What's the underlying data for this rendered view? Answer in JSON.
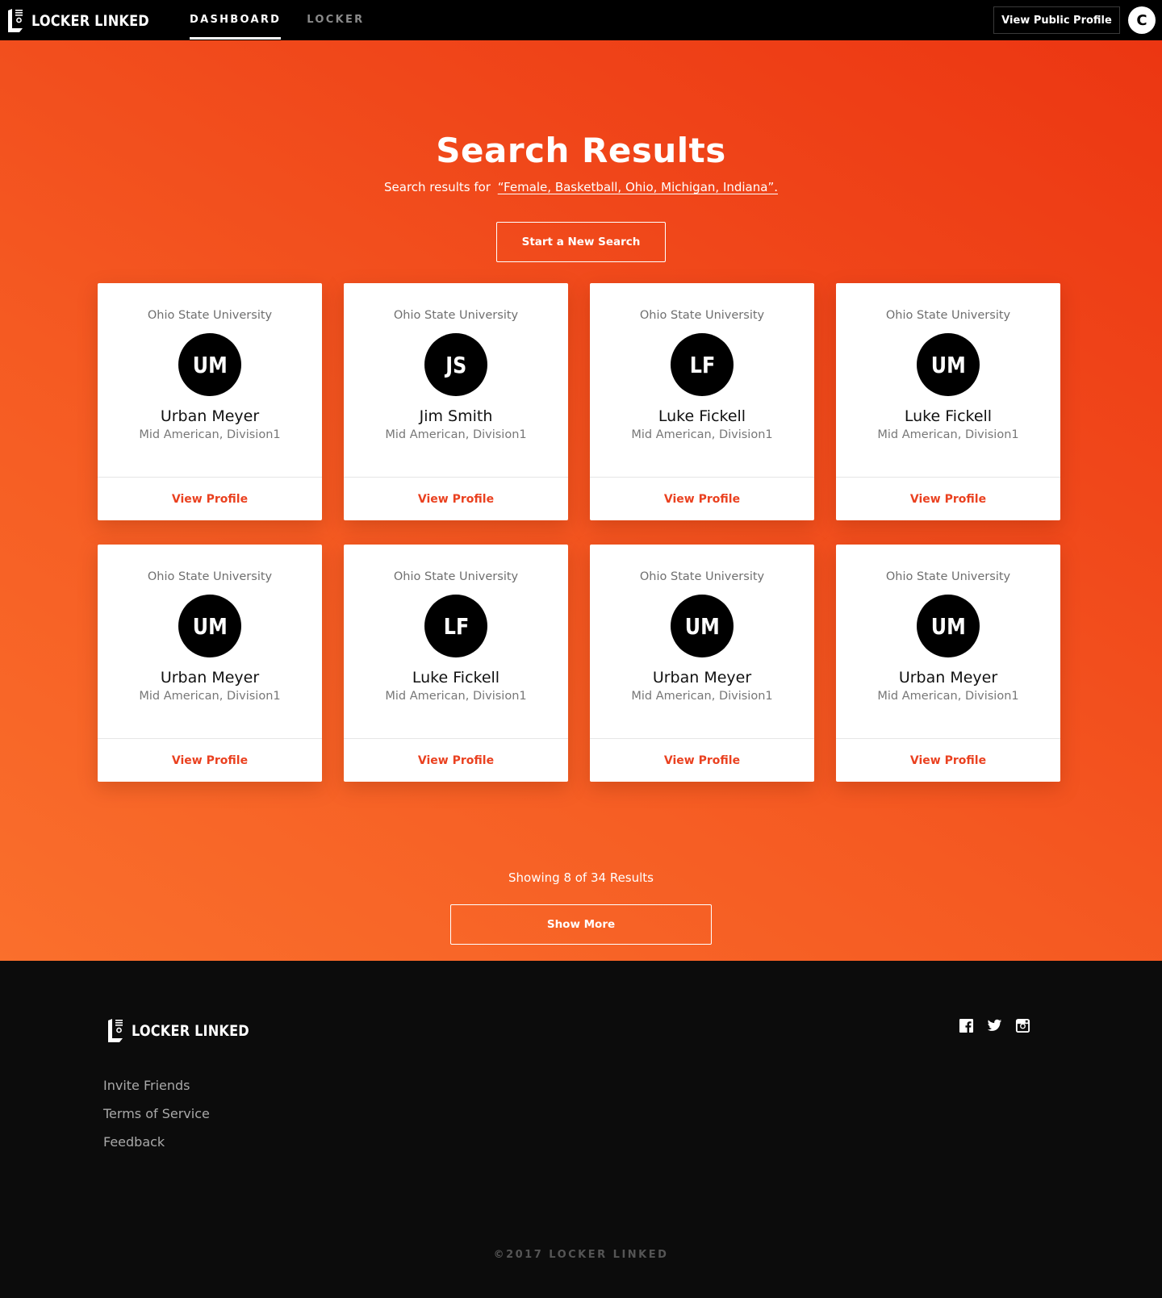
{
  "header": {
    "brand": "LOCKER LINKED",
    "nav": [
      {
        "label": "DASHBOARD",
        "active": true
      },
      {
        "label": "LOCKER",
        "active": false
      }
    ],
    "view_public_profile": "View Public Profile",
    "user_initial": "C"
  },
  "colors": {
    "accent": "#ea4120",
    "hero_gradient_start": "#ec3612",
    "hero_gradient_end": "#fa6f2c",
    "header_bg": "#000000",
    "footer_bg": "#0c0c0c"
  },
  "hero": {
    "title": "Search Results",
    "subtitle_prefix": "Search results for",
    "query": "“Female, Basketball, Ohio, Michigan, Indiana”.",
    "new_search_label": "Start a New Search"
  },
  "results": [
    {
      "school": "Ohio State University",
      "initials": "UM",
      "name": "Urban Meyer",
      "conference": "Mid American, Division1",
      "action": "View Profile"
    },
    {
      "school": "Ohio State University",
      "initials": "JS",
      "name": "Jim Smith",
      "conference": "Mid American, Division1",
      "action": "View Profile"
    },
    {
      "school": "Ohio State University",
      "initials": "LF",
      "name": "Luke Fickell",
      "conference": "Mid American, Division1",
      "action": "View Profile"
    },
    {
      "school": "Ohio State University",
      "initials": "UM",
      "name": "Luke Fickell",
      "conference": "Mid American, Division1",
      "action": "View Profile"
    },
    {
      "school": "Ohio State University",
      "initials": "UM",
      "name": "Urban Meyer",
      "conference": "Mid American, Division1",
      "action": "View Profile"
    },
    {
      "school": "Ohio State University",
      "initials": "LF",
      "name": "Luke Fickell",
      "conference": "Mid American, Division1",
      "action": "View Profile"
    },
    {
      "school": "Ohio State University",
      "initials": "UM",
      "name": "Urban Meyer",
      "conference": "Mid American, Division1",
      "action": "View Profile"
    },
    {
      "school": "Ohio State University",
      "initials": "UM",
      "name": "Urban Meyer",
      "conference": "Mid American, Division1",
      "action": "View Profile"
    }
  ],
  "pagination": {
    "summary": "Showing 8 of 34 Results",
    "shown": 8,
    "total": 34,
    "show_more_label": "Show More"
  },
  "footer": {
    "brand": "LOCKER LINKED",
    "links": [
      "Invite Friends",
      "Terms of Service",
      "Feedback"
    ],
    "social": [
      "facebook-icon",
      "twitter-icon",
      "instagram-icon"
    ],
    "copyright": "©2017 LOCKER LINKED"
  }
}
